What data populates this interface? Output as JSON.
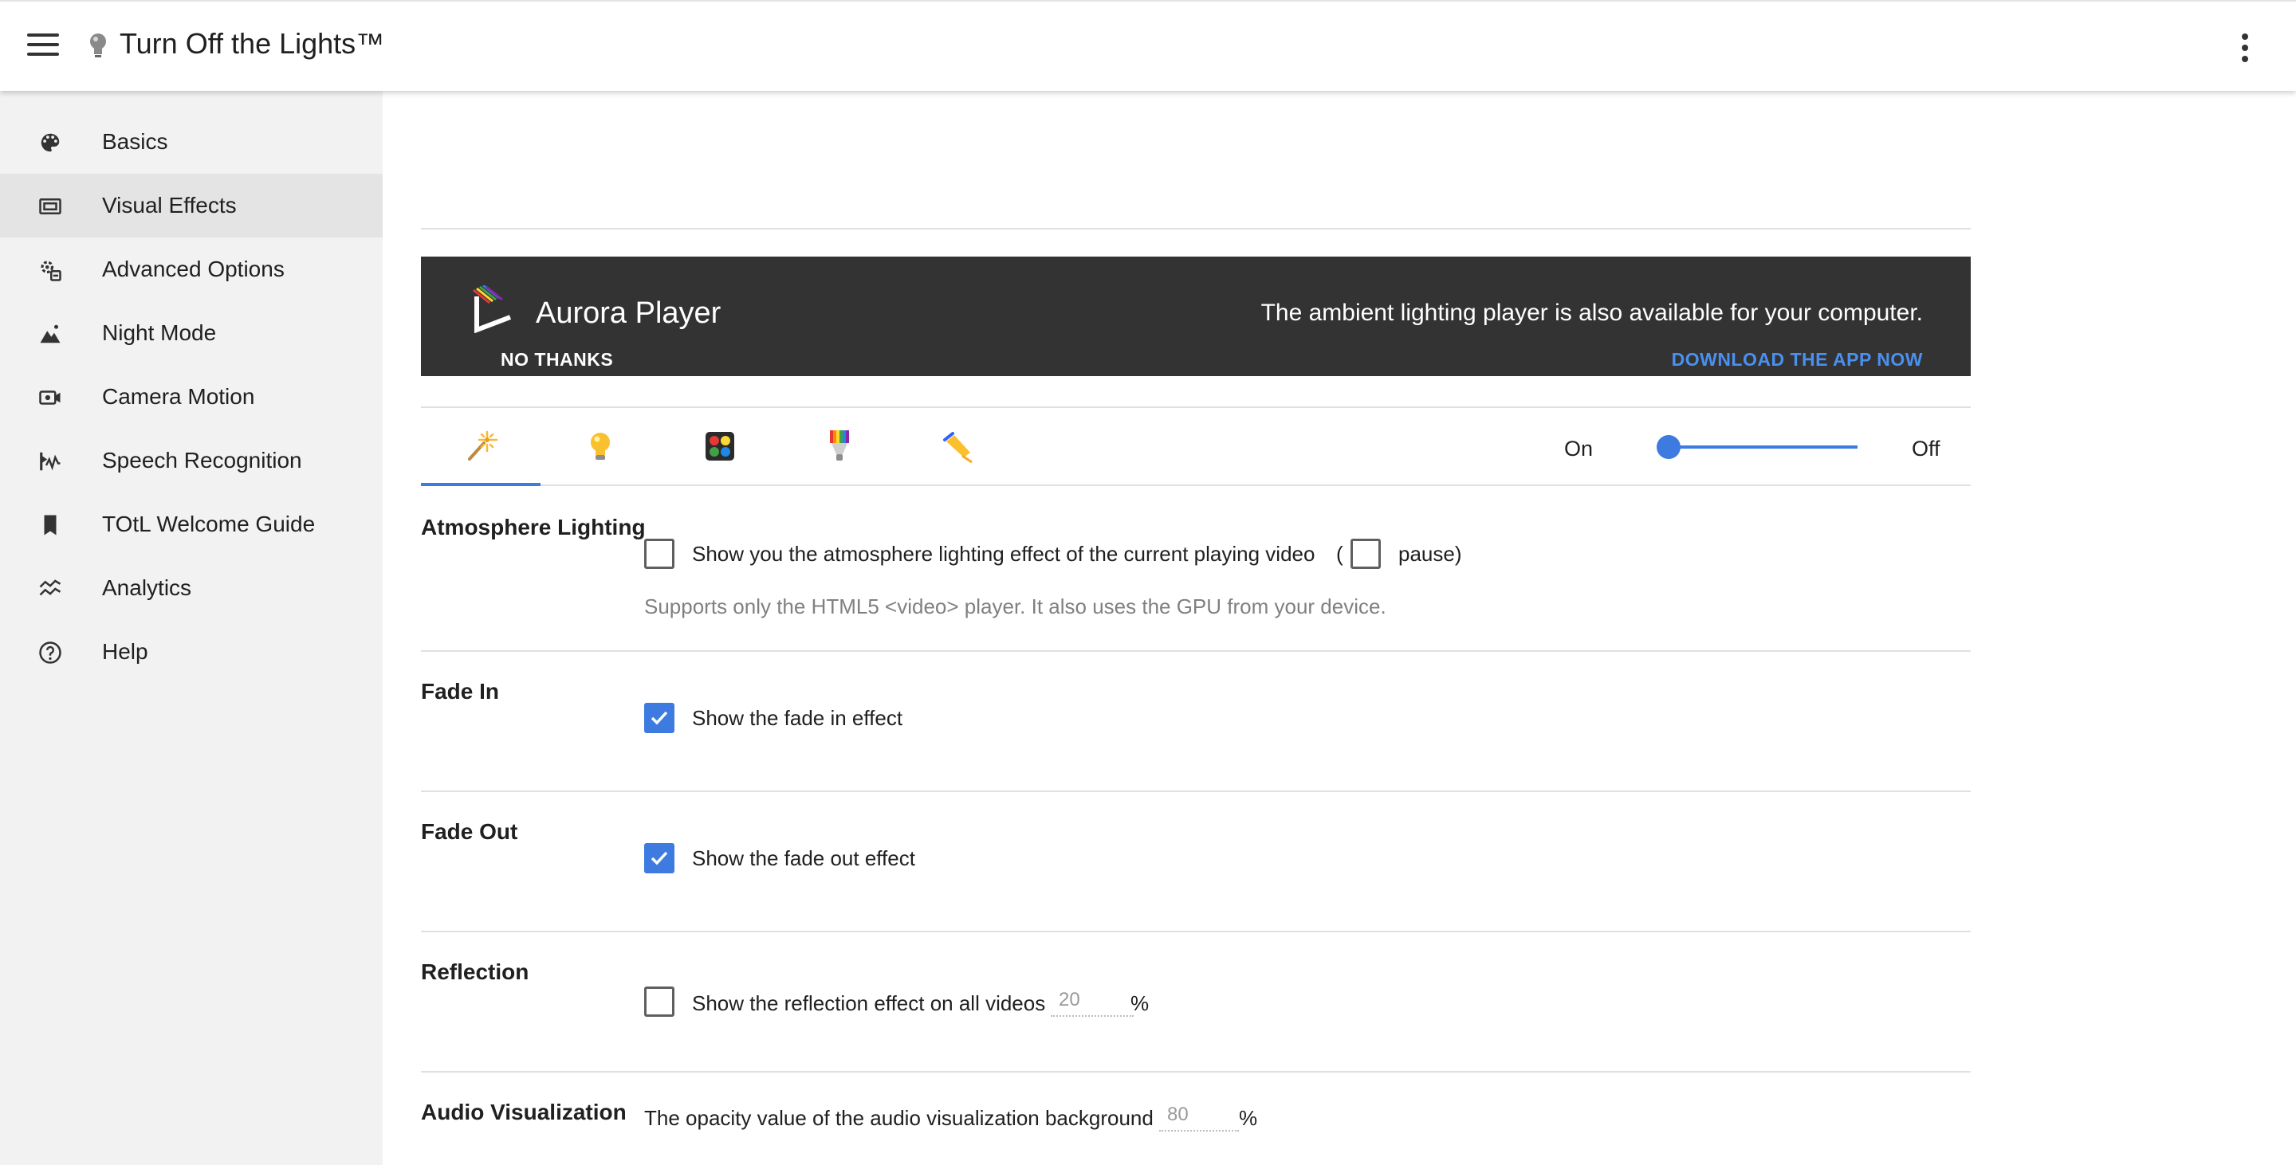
{
  "app": {
    "title": "Turn Off the Lights™"
  },
  "sidebar": {
    "items": [
      {
        "label": "Basics",
        "icon": "palette-icon"
      },
      {
        "label": "Visual Effects",
        "icon": "video-frame-icon",
        "active": true
      },
      {
        "label": "Advanced Options",
        "icon": "advanced-settings-icon"
      },
      {
        "label": "Night Mode",
        "icon": "landscape-icon"
      },
      {
        "label": "Camera Motion",
        "icon": "camera-motion-icon"
      },
      {
        "label": "Speech Recognition",
        "icon": "speech-wave-icon"
      },
      {
        "label": "TOtL Welcome Guide",
        "icon": "bookmark-icon"
      },
      {
        "label": "Analytics",
        "icon": "analytics-icon"
      },
      {
        "label": "Help",
        "icon": "help-icon"
      }
    ]
  },
  "banner": {
    "title": "Aurora Player",
    "message": "The ambient lighting player is also available for your computer.",
    "dismiss_label": "NO THANKS",
    "download_label": "DOWNLOAD THE APP NOW",
    "background": "#333333",
    "link_color": "#4a90f0"
  },
  "tabs": [
    {
      "icon": "magic-wand-icon",
      "active": true
    },
    {
      "icon": "lightbulb-icon"
    },
    {
      "icon": "color-palette-grid-icon"
    },
    {
      "icon": "rainbow-bulb-icon"
    },
    {
      "icon": "flashlight-icon"
    }
  ],
  "toggle": {
    "on_label": "On",
    "off_label": "Off",
    "value": "on"
  },
  "sections": {
    "atmosphere": {
      "title": "Atmosphere Lighting",
      "label": "Show you the atmosphere lighting effect of the current playing video",
      "checked": false,
      "paren_open": "(",
      "pause_label": "pause)",
      "pause_checked": false,
      "hint": "Supports only the HTML5 <video> player. It also uses the GPU from your device."
    },
    "fade_in": {
      "title": "Fade In",
      "label": "Show the fade in effect",
      "checked": true
    },
    "fade_out": {
      "title": "Fade Out",
      "label": "Show the fade out effect",
      "checked": true
    },
    "reflection": {
      "title": "Reflection",
      "label": "Show the reflection effect on all videos",
      "checked": false,
      "value": "20",
      "unit": "%"
    },
    "audio": {
      "title": "Audio Visualization",
      "label": "The opacity value of the audio visualization background",
      "value": "80",
      "unit": "%"
    }
  },
  "colors": {
    "accent": "#3d7be0",
    "sidebar_bg": "#f2f2f2",
    "sidebar_active": "#e4e4e4"
  }
}
